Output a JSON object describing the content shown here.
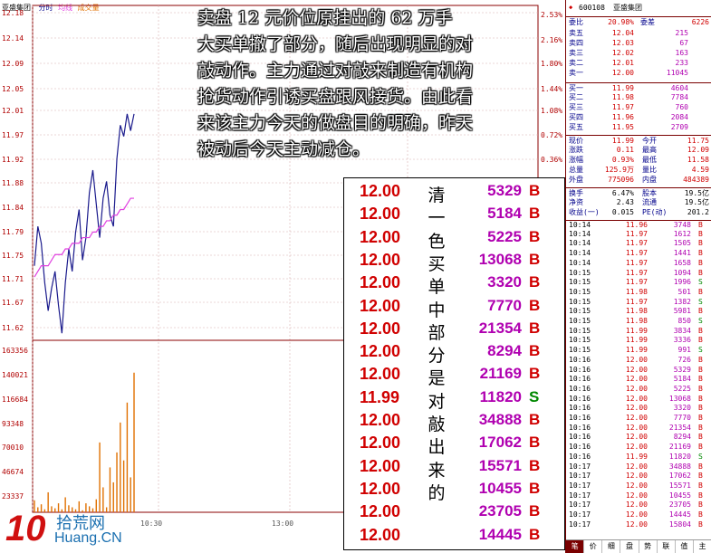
{
  "chart_header": {
    "stock_name": "亚盛集团",
    "tab_time": "分时",
    "tab_avg": "均线",
    "tab_volume": "成交量"
  },
  "price_axis": {
    "left_ticks": [
      "12.18",
      "12.14",
      "12.09",
      "12.05",
      "12.01",
      "11.97",
      "11.92",
      "11.88",
      "11.84",
      "11.79",
      "11.75",
      "11.71",
      "11.67",
      "11.62"
    ],
    "right_ticks": [
      "2.53%",
      "2.16%",
      "1.80%",
      "1.44%",
      "1.08%",
      "0.72%",
      "0.36%"
    ]
  },
  "volume_axis": {
    "ticks": [
      "163356",
      "140021",
      "116684",
      "93348",
      "70010",
      "46674",
      "23337"
    ]
  },
  "time_axis": {
    "ticks": [
      "10:30",
      "13:00"
    ]
  },
  "note": {
    "lines": [
      "卖盘 12 元价位原挂出的 62 万手",
      "大买单撤了部分，随后出现明显的对",
      "敲动作。主力通过对敲来制造有机构",
      "抢货动作引诱买盘跟风接货。由此看",
      "来该主力今天的做盘目的明确，昨天",
      "被动后今天主动减仓。"
    ]
  },
  "highlight_trades": [
    {
      "price": "12.00",
      "char": "清",
      "vol": "5329",
      "dir": "B"
    },
    {
      "price": "12.00",
      "char": "一",
      "vol": "5184",
      "dir": "B"
    },
    {
      "price": "12.00",
      "char": "色",
      "vol": "5225",
      "dir": "B"
    },
    {
      "price": "12.00",
      "char": "买",
      "vol": "13068",
      "dir": "B"
    },
    {
      "price": "12.00",
      "char": "单",
      "vol": "3320",
      "dir": "B"
    },
    {
      "price": "12.00",
      "char": "中",
      "vol": "7770",
      "dir": "B"
    },
    {
      "price": "12.00",
      "char": "部",
      "vol": "21354",
      "dir": "B"
    },
    {
      "price": "12.00",
      "char": "分",
      "vol": "8294",
      "dir": "B"
    },
    {
      "price": "12.00",
      "char": "是",
      "vol": "21169",
      "dir": "B"
    },
    {
      "price": "11.99",
      "char": "对",
      "vol": "11820",
      "dir": "S"
    },
    {
      "price": "12.00",
      "char": "敲",
      "vol": "34888",
      "dir": "B"
    },
    {
      "price": "12.00",
      "char": "出",
      "vol": "17062",
      "dir": "B"
    },
    {
      "price": "12.00",
      "char": "来",
      "vol": "15571",
      "dir": "B"
    },
    {
      "price": "12.00",
      "char": "的",
      "vol": "10455",
      "dir": "B"
    },
    {
      "price": "12.00",
      "char": "",
      "vol": "23705",
      "dir": "B"
    },
    {
      "price": "12.00",
      "char": "",
      "vol": "14445",
      "dir": "B"
    }
  ],
  "panel": {
    "code": "600108",
    "name": "亚盛集团",
    "ratio": {
      "label1": "委比",
      "v1": "20.98%",
      "label2": "委差",
      "v2": "6226"
    },
    "asks": [
      {
        "label": "卖五",
        "price": "12.04",
        "vol": "215"
      },
      {
        "label": "卖四",
        "price": "12.03",
        "vol": "67"
      },
      {
        "label": "卖三",
        "price": "12.02",
        "vol": "163"
      },
      {
        "label": "卖二",
        "price": "12.01",
        "vol": "233"
      },
      {
        "label": "卖一",
        "price": "12.00",
        "vol": "11045"
      }
    ],
    "bids": [
      {
        "label": "买一",
        "price": "11.99",
        "vol": "4604"
      },
      {
        "label": "买二",
        "price": "11.98",
        "vol": "7784"
      },
      {
        "label": "买三",
        "price": "11.97",
        "vol": "760"
      },
      {
        "label": "买四",
        "price": "11.96",
        "vol": "2084"
      },
      {
        "label": "买五",
        "price": "11.95",
        "vol": "2709"
      }
    ],
    "stats": [
      {
        "l1": "现价",
        "v1": "11.99",
        "l2": "今开",
        "v2": "11.75"
      },
      {
        "l1": "涨跌",
        "v1": "0.11",
        "l2": "最高",
        "v2": "12.09"
      },
      {
        "l1": "涨幅",
        "v1": "0.93%",
        "l2": "最低",
        "v2": "11.58"
      },
      {
        "l1": "总量",
        "v1": "125.9万",
        "l2": "量比",
        "v2": "4.59"
      },
      {
        "l1": "外盘",
        "v1": "775096",
        "l2": "内盘",
        "v2": "484389"
      }
    ],
    "stats2": [
      {
        "l1": "换手",
        "v1": "6.47%",
        "l2": "股本",
        "v2": "19.5亿"
      },
      {
        "l1": "净资",
        "v1": "2.43",
        "l2": "流通",
        "v2": "19.5亿"
      },
      {
        "l1": "收益(一)",
        "v1": "0.015",
        "l2": "PE(动)",
        "v2": "201.2"
      }
    ],
    "ticks": [
      {
        "time": "10:14",
        "price": "11.96",
        "vol": "3748",
        "dir": "B"
      },
      {
        "time": "10:14",
        "price": "11.97",
        "vol": "1612",
        "dir": "B"
      },
      {
        "time": "10:14",
        "price": "11.97",
        "vol": "1505",
        "dir": "B"
      },
      {
        "time": "10:14",
        "price": "11.97",
        "vol": "1441",
        "dir": "B"
      },
      {
        "time": "10:14",
        "price": "11.97",
        "vol": "1658",
        "dir": "B"
      },
      {
        "time": "10:15",
        "price": "11.97",
        "vol": "1094",
        "dir": "B"
      },
      {
        "time": "10:15",
        "price": "11.97",
        "vol": "1996",
        "dir": "S"
      },
      {
        "time": "10:15",
        "price": "11.98",
        "vol": "501",
        "dir": "B"
      },
      {
        "time": "10:15",
        "price": "11.97",
        "vol": "1382",
        "dir": "S"
      },
      {
        "time": "10:15",
        "price": "11.98",
        "vol": "5981",
        "dir": "B"
      },
      {
        "time": "10:15",
        "price": "11.98",
        "vol": "850",
        "dir": "S"
      },
      {
        "time": "10:15",
        "price": "11.99",
        "vol": "3834",
        "dir": "B"
      },
      {
        "time": "10:15",
        "price": "11.99",
        "vol": "3336",
        "dir": "B"
      },
      {
        "time": "10:15",
        "price": "11.99",
        "vol": "991",
        "dir": "S"
      },
      {
        "time": "10:16",
        "price": "12.00",
        "vol": "726",
        "dir": "B"
      },
      {
        "time": "10:16",
        "price": "12.00",
        "vol": "5329",
        "dir": "B"
      },
      {
        "time": "10:16",
        "price": "12.00",
        "vol": "5184",
        "dir": "B"
      },
      {
        "time": "10:16",
        "price": "12.00",
        "vol": "5225",
        "dir": "B"
      },
      {
        "time": "10:16",
        "price": "12.00",
        "vol": "13068",
        "dir": "B"
      },
      {
        "time": "10:16",
        "price": "12.00",
        "vol": "3320",
        "dir": "B"
      },
      {
        "time": "10:16",
        "price": "12.00",
        "vol": "7770",
        "dir": "B"
      },
      {
        "time": "10:16",
        "price": "12.00",
        "vol": "21354",
        "dir": "B"
      },
      {
        "time": "10:16",
        "price": "12.00",
        "vol": "8294",
        "dir": "B"
      },
      {
        "time": "10:16",
        "price": "12.00",
        "vol": "21169",
        "dir": "B"
      },
      {
        "time": "10:16",
        "price": "11.99",
        "vol": "11820",
        "dir": "S"
      },
      {
        "time": "10:17",
        "price": "12.00",
        "vol": "34888",
        "dir": "B"
      },
      {
        "time": "10:17",
        "price": "12.00",
        "vol": "17062",
        "dir": "B"
      },
      {
        "time": "10:17",
        "price": "12.00",
        "vol": "15571",
        "dir": "B"
      },
      {
        "time": "10:17",
        "price": "12.00",
        "vol": "10455",
        "dir": "B"
      },
      {
        "time": "10:17",
        "price": "12.00",
        "vol": "23705",
        "dir": "B"
      },
      {
        "time": "10:17",
        "price": "12.00",
        "vol": "14445",
        "dir": "B"
      },
      {
        "time": "10:17",
        "price": "12.00",
        "vol": "15804",
        "dir": "B"
      }
    ],
    "bottom_tabs": [
      "笔",
      "价",
      "细",
      "盘",
      "势",
      "联",
      "值",
      "主"
    ]
  },
  "watermark": {
    "digits": "10",
    "brand": "拾荒网",
    "domain": "Huang.CN"
  },
  "colors": {
    "price_line": "#1a1a8c",
    "avg_line": "#e040e0",
    "volume_bar": "#e07000",
    "buy": "#d00000",
    "sell": "#008800"
  }
}
